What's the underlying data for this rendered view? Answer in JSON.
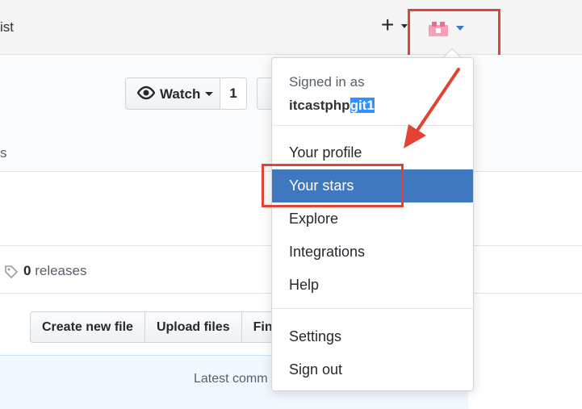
{
  "header": {
    "left_text": "ist",
    "plus_label": "+"
  },
  "repo": {
    "watch_label": "Watch",
    "watch_count": "1",
    "tab_fragment": "s",
    "releases_count": "0",
    "releases_label": "releases"
  },
  "file_buttons": {
    "create": "Create new file",
    "upload": "Upload files",
    "find": "Find"
  },
  "commit": {
    "text": "Latest comm"
  },
  "dropdown": {
    "signed_in_label": "Signed in as",
    "username_prefix": "itcastphp",
    "username_selected": "git1",
    "items": [
      "Your profile",
      "Your stars",
      "Explore",
      "Integrations",
      "Help",
      "Settings",
      "Sign out"
    ],
    "active_item": "Your stars"
  },
  "colors": {
    "annotation": "#e34234",
    "active_item_bg": "#4078c0",
    "text_selection": "#3390ff"
  },
  "icons": {
    "avatar": "avatar-icon",
    "watch": "eye-icon",
    "releases": "tag-icon",
    "annotation_arrow": "arrow-icon"
  }
}
